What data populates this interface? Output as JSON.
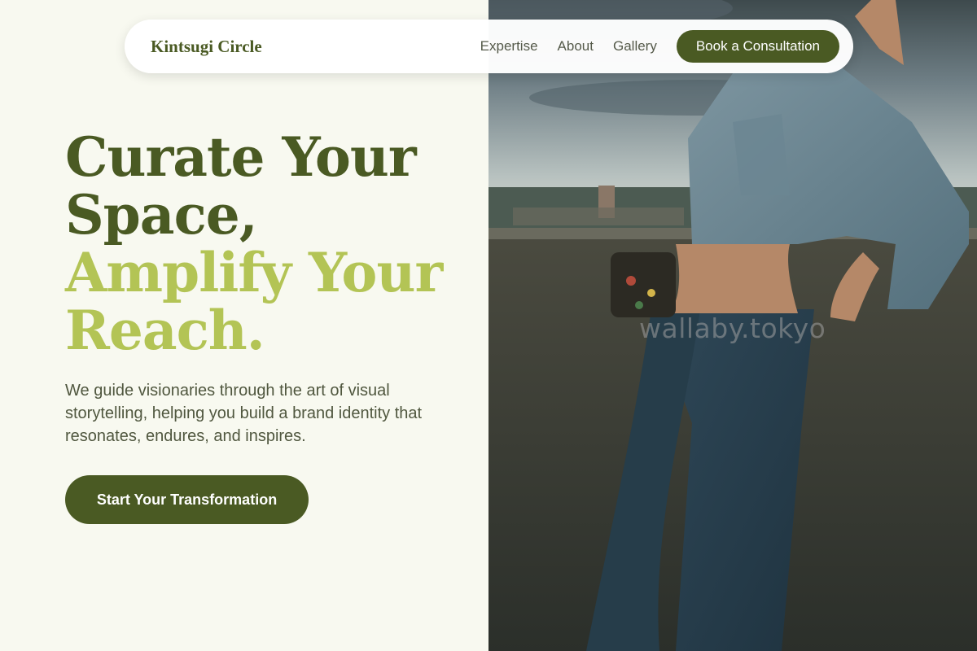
{
  "nav": {
    "brand": "Kintsugi Circle",
    "links": [
      "Expertise",
      "About",
      "Gallery"
    ],
    "cta": "Book a Consultation"
  },
  "hero": {
    "headline_line1": "Curate Your",
    "headline_line2": "Space,",
    "headline_line3": "Amplify Your",
    "headline_line4": "Reach.",
    "description": "We guide visionaries through the art of visual storytelling, helping you build a brand identity that resonates, endures, and inspires.",
    "cta": "Start Your Transformation"
  },
  "photo": {
    "watermark": "wallaby.tokyo"
  },
  "colors": {
    "brand_dark": "#4a5a23",
    "brand_light": "#b3c455",
    "background": "#f8f9f0"
  }
}
